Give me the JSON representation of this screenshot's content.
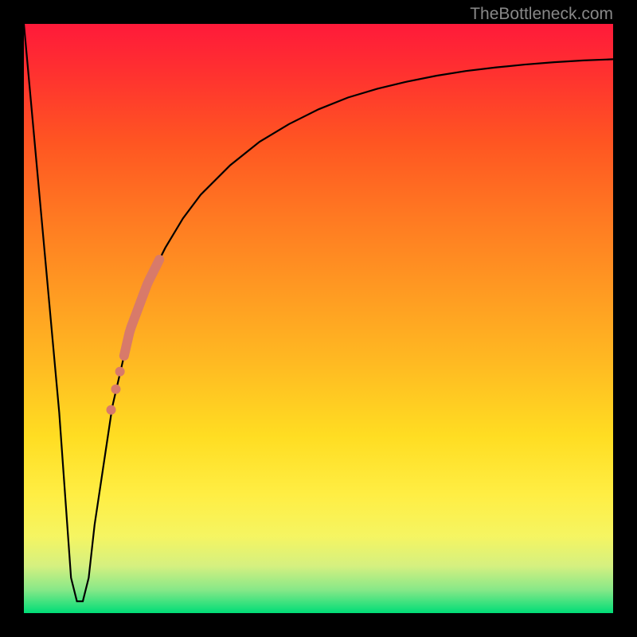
{
  "watermark": "TheBottleneck.com",
  "chart_data": {
    "type": "line",
    "title": "",
    "xlabel": "",
    "ylabel": "",
    "xlim": [
      0,
      100
    ],
    "ylim": [
      0,
      100
    ],
    "grid": false,
    "series": [
      {
        "name": "bottleneck-curve",
        "x": [
          0,
          3,
          6,
          8,
          9,
          10,
          11,
          12,
          15,
          18,
          21,
          24,
          27,
          30,
          35,
          40,
          45,
          50,
          55,
          60,
          65,
          70,
          75,
          80,
          85,
          90,
          95,
          100
        ],
        "values": [
          100,
          67,
          34,
          6,
          2,
          2,
          6,
          15,
          35,
          48,
          56,
          62,
          67,
          71,
          76,
          80,
          83,
          85.5,
          87.5,
          89,
          90.2,
          91.2,
          92,
          92.6,
          93.1,
          93.5,
          93.8,
          94
        ]
      }
    ],
    "highlight_segment": {
      "name": "highlight-band",
      "color": "#d87a6a",
      "x_range": [
        17,
        23
      ],
      "values_range": [
        43,
        60
      ],
      "width": 12
    },
    "highlight_dots": {
      "name": "highlight-dots",
      "color": "#d87a6a",
      "radius": 6,
      "points": [
        {
          "x": 16.3,
          "y": 41
        },
        {
          "x": 15.6,
          "y": 38
        },
        {
          "x": 14.8,
          "y": 34.5
        }
      ]
    }
  }
}
